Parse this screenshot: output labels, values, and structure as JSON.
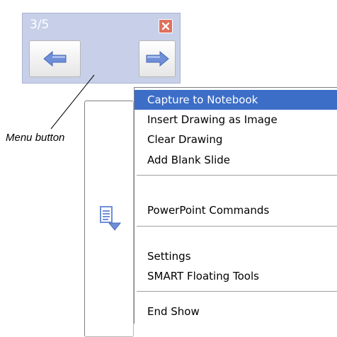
{
  "toolbar": {
    "page_indicator": "3/5",
    "buttons": {
      "prev_icon": "left-arrow-icon",
      "menu_icon": "document-menu-icon",
      "next_icon": "right-arrow-icon",
      "close_icon": "close-icon"
    }
  },
  "callout": {
    "label": "Menu button"
  },
  "menu": {
    "items": [
      {
        "label": "Capture to Notebook",
        "selected": true
      },
      {
        "label": "Insert Drawing as Image",
        "selected": false
      },
      {
        "label": "Clear Drawing",
        "selected": false
      },
      {
        "label": "Add Blank Slide",
        "selected": false
      },
      {
        "label": "PowerPoint Commands",
        "selected": false
      },
      {
        "label": "Settings",
        "selected": false
      },
      {
        "label": "SMART Floating Tools",
        "selected": false
      },
      {
        "label": "End Show",
        "selected": false
      }
    ]
  },
  "colors": {
    "toolbar_bg": "#c7d0e8",
    "arrow_blue": "#6f8fd8",
    "highlight": "#3d6ec7",
    "close_red": "#e0705c"
  }
}
